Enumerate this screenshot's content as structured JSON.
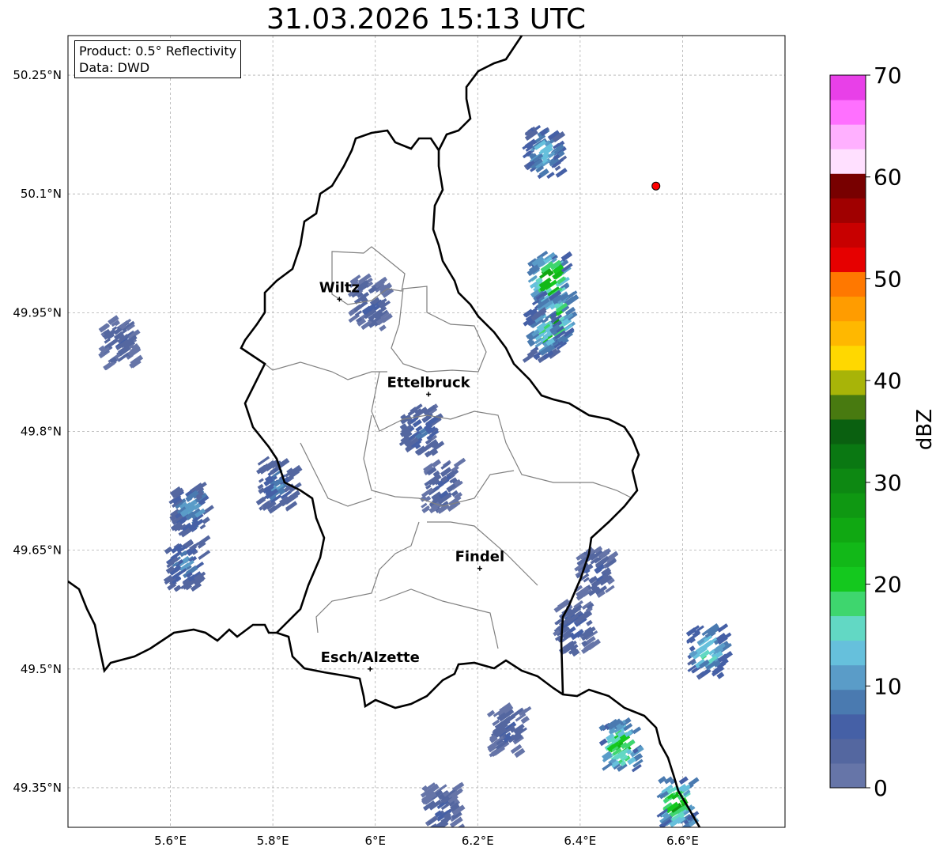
{
  "title": "31.03.2026 15:13 UTC",
  "info_box": {
    "product": "Product: 0.5° Reflectivity",
    "data": "Data: DWD"
  },
  "axes": {
    "lon_ticks": [
      "5.6°E",
      "5.8°E",
      "6°E",
      "6.2°E",
      "6.4°E",
      "6.6°E"
    ],
    "lat_ticks": [
      "50.25°N",
      "50.1°N",
      "49.95°N",
      "49.8°N",
      "49.65°N",
      "49.5°N",
      "49.35°N"
    ],
    "lon_values": [
      5.6,
      5.8,
      6.0,
      6.2,
      6.4,
      6.6
    ],
    "lat_values": [
      50.25,
      50.1,
      49.95,
      49.8,
      49.65,
      49.5,
      49.35
    ],
    "lon_range": [
      5.4,
      6.8
    ],
    "lat_range": [
      49.3,
      50.3
    ]
  },
  "colorbar": {
    "label": "dBZ",
    "ticks": [
      "0",
      "10",
      "20",
      "30",
      "40",
      "50",
      "60",
      "70"
    ],
    "range": [
      0,
      70
    ],
    "colors": [
      "#6675a8",
      "#5467a0",
      "#4560a6",
      "#4a7ab0",
      "#5a9cc8",
      "#66c0dc",
      "#62d8c4",
      "#3ed66e",
      "#14c81e",
      "#12b818",
      "#10a812",
      "#0f9812",
      "#0d8812",
      "#0a7812",
      "#0a6010",
      "#487a10",
      "#a8b408",
      "#ffd800",
      "#ffb800",
      "#ff9c00",
      "#ff7800",
      "#e60000",
      "#c80000",
      "#a00000",
      "#780000",
      "#ffe0ff",
      "#ffb0ff",
      "#ff70ff",
      "#e840e8"
    ]
  },
  "places": [
    {
      "name": "Wiltz",
      "lon": 5.93,
      "lat": 49.967
    },
    {
      "name": "Ettelbruck",
      "lon": 6.104,
      "lat": 49.847
    },
    {
      "name": "Findel",
      "lon": 6.204,
      "lat": 49.627
    },
    {
      "name": "Esch/Alzette",
      "lon": 5.99,
      "lat": 49.5
    }
  ],
  "radar_site": {
    "lon": 6.548,
    "lat": 50.11
  },
  "radar_cells": [
    {
      "lon": 6.32,
      "lat": 50.15,
      "dbz": 15
    },
    {
      "lon": 6.33,
      "lat": 49.99,
      "dbz": 28
    },
    {
      "lon": 6.34,
      "lat": 49.94,
      "dbz": 24
    },
    {
      "lon": 6.32,
      "lat": 49.92,
      "dbz": 16
    },
    {
      "lon": 6.08,
      "lat": 49.8,
      "dbz": 8
    },
    {
      "lon": 6.12,
      "lat": 49.73,
      "dbz": 6
    },
    {
      "lon": 5.8,
      "lat": 49.73,
      "dbz": 9
    },
    {
      "lon": 5.63,
      "lat": 49.7,
      "dbz": 12
    },
    {
      "lon": 5.62,
      "lat": 49.63,
      "dbz": 10
    },
    {
      "lon": 5.49,
      "lat": 49.91,
      "dbz": 5
    },
    {
      "lon": 6.64,
      "lat": 49.52,
      "dbz": 18
    },
    {
      "lon": 6.47,
      "lat": 49.4,
      "dbz": 24
    },
    {
      "lon": 6.58,
      "lat": 49.33,
      "dbz": 26
    },
    {
      "lon": 6.38,
      "lat": 49.55,
      "dbz": 7
    },
    {
      "lon": 6.25,
      "lat": 49.42,
      "dbz": 5
    },
    {
      "lon": 6.12,
      "lat": 49.32,
      "dbz": 5
    },
    {
      "lon": 6.42,
      "lat": 49.62,
      "dbz": 6
    },
    {
      "lon": 5.98,
      "lat": 49.96,
      "dbz": 6
    }
  ]
}
